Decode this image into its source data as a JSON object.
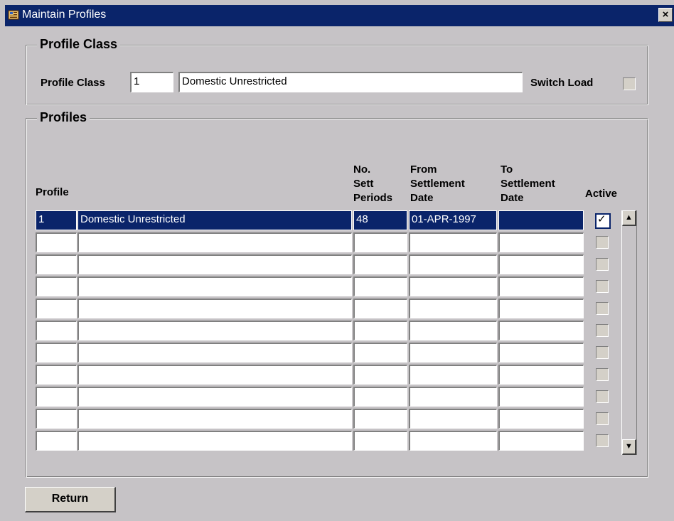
{
  "window": {
    "title": "Maintain Profiles",
    "close_glyph": "×",
    "icon": "form-icon"
  },
  "profile_class_group": {
    "legend": "Profile Class",
    "profile_class_label": "Profile Class",
    "profile_class_code": "1",
    "profile_class_description": "Domestic Unrestricted",
    "switch_load_label": "Switch Load",
    "switch_load_checked": false
  },
  "profiles_group": {
    "legend": "Profiles",
    "columns": {
      "profile": "Profile",
      "sett_periods_line1": "No.",
      "sett_periods_line2": "Sett",
      "sett_periods_line3": "Periods",
      "from_line1": "From",
      "from_line2": "Settlement",
      "from_line3": "Date",
      "to_line1": "To",
      "to_line2": "Settlement",
      "to_line3": "Date",
      "active": "Active"
    },
    "rows": [
      {
        "profile": "1",
        "description": "Domestic Unrestricted",
        "sett_periods": "48",
        "from_date": "01-APR-1997",
        "to_date": "",
        "active": true,
        "selected": true
      },
      {
        "profile": "",
        "description": "",
        "sett_periods": "",
        "from_date": "",
        "to_date": "",
        "active": false,
        "selected": false
      },
      {
        "profile": "",
        "description": "",
        "sett_periods": "",
        "from_date": "",
        "to_date": "",
        "active": false,
        "selected": false
      },
      {
        "profile": "",
        "description": "",
        "sett_periods": "",
        "from_date": "",
        "to_date": "",
        "active": false,
        "selected": false
      },
      {
        "profile": "",
        "description": "",
        "sett_periods": "",
        "from_date": "",
        "to_date": "",
        "active": false,
        "selected": false
      },
      {
        "profile": "",
        "description": "",
        "sett_periods": "",
        "from_date": "",
        "to_date": "",
        "active": false,
        "selected": false
      },
      {
        "profile": "",
        "description": "",
        "sett_periods": "",
        "from_date": "",
        "to_date": "",
        "active": false,
        "selected": false
      },
      {
        "profile": "",
        "description": "",
        "sett_periods": "",
        "from_date": "",
        "to_date": "",
        "active": false,
        "selected": false
      },
      {
        "profile": "",
        "description": "",
        "sett_periods": "",
        "from_date": "",
        "to_date": "",
        "active": false,
        "selected": false
      },
      {
        "profile": "",
        "description": "",
        "sett_periods": "",
        "from_date": "",
        "to_date": "",
        "active": false,
        "selected": false
      },
      {
        "profile": "",
        "description": "",
        "sett_periods": "",
        "from_date": "",
        "to_date": "",
        "active": false,
        "selected": false
      }
    ],
    "scroll_up_glyph": "▲",
    "scroll_down_glyph": "▼"
  },
  "footer": {
    "return_label": "Return"
  }
}
